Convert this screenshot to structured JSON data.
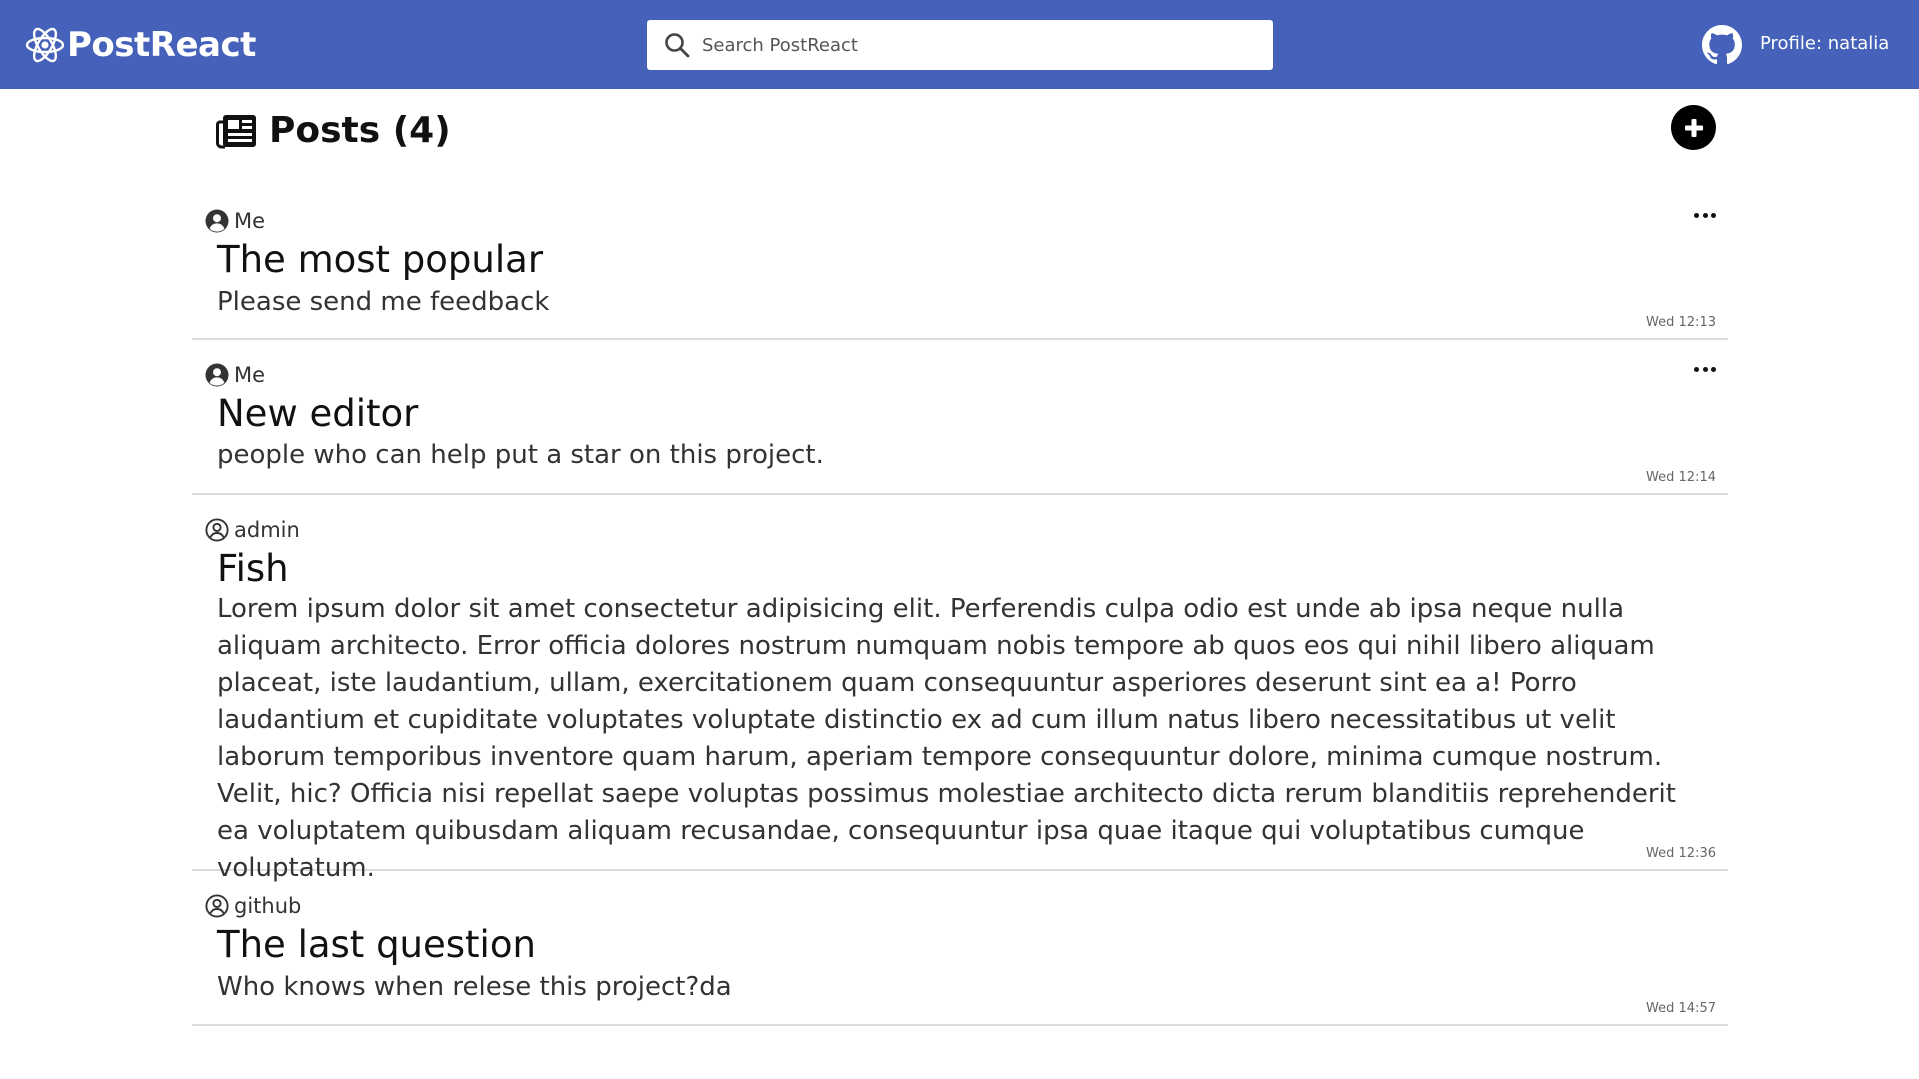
{
  "app": {
    "name": "PostReact",
    "brand_color": "#4561b9"
  },
  "header": {
    "search": {
      "placeholder": "Search PostReact",
      "value": ""
    },
    "profile_label": "Profile: natalia"
  },
  "main": {
    "title": "Posts (4)",
    "add_button_icon": "plus-circle-icon"
  },
  "posts": [
    {
      "author": "Me",
      "author_icon": "user-circle-solid-icon",
      "title": "The most popular",
      "body": "Please send me feedback",
      "time": "Wed 12:13",
      "has_menu": true
    },
    {
      "author": "Me",
      "author_icon": "user-circle-solid-icon",
      "title": "New editor",
      "body": "people who can help put a star on this project.",
      "time": "Wed 12:14",
      "has_menu": true
    },
    {
      "author": "admin",
      "author_icon": "user-circle-outline-icon",
      "title": "Fish",
      "body": "Lorem ipsum dolor sit amet consectetur adipisicing elit. Perferendis culpa odio est unde ab ipsa neque nulla aliquam architecto. Error officia dolores nostrum numquam nobis tempore ab quos eos qui nihil libero aliquam placeat, iste laudantium, ullam, exercitationem quam consequuntur asperiores deserunt sint ea a! Porro laudantium et cupiditate voluptates voluptate distinctio ex ad cum illum natus libero necessitatibus ut velit laborum temporibus inventore quam harum, aperiam tempore consequuntur dolore, minima cumque nostrum. Velit, hic? Officia nisi repellat saepe voluptas possimus molestiae architecto dicta rerum blanditiis reprehenderit ea voluptatem quibusdam aliquam recusandae, consequuntur ipsa quae itaque qui voluptatibus cumque voluptatum.",
      "time": "Wed 12:36",
      "has_menu": false
    },
    {
      "author": "github",
      "author_icon": "user-circle-outline-icon",
      "title": "The last question",
      "body": "Who knows when relese this project?da",
      "time": "Wed 14:57",
      "has_menu": false
    }
  ]
}
